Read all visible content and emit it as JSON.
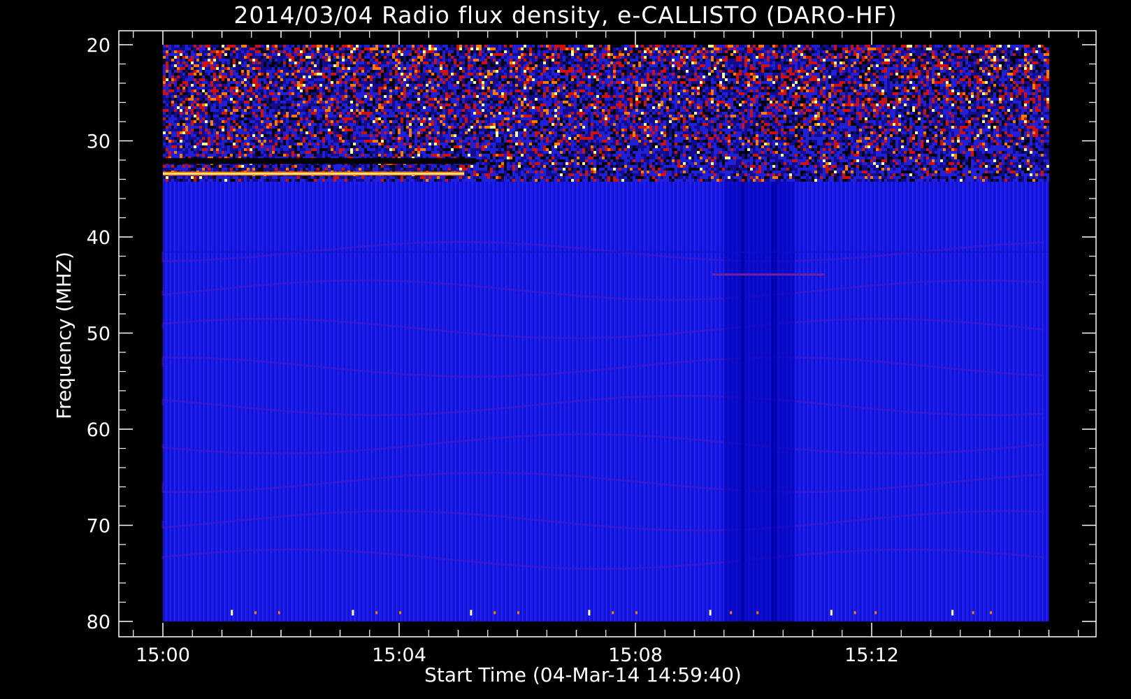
{
  "chart_data": {
    "type": "heatmap",
    "title": "2014/03/04  Radio flux density, e-CALLISTO (DARO-HF)",
    "xlabel": "Start Time (04-Mar-14 14:59:40)",
    "ylabel": "Frequency (MHZ)",
    "x_tick_labels": [
      "15:00",
      "15:04",
      "15:08",
      "15:12"
    ],
    "x_tick_minutes": [
      0,
      4,
      8,
      12
    ],
    "y_tick_labels": [
      "20",
      "30",
      "40",
      "50",
      "60",
      "70",
      "80"
    ],
    "y_tick_values": [
      20,
      30,
      40,
      50,
      60,
      70,
      80
    ],
    "ylim": [
      80,
      20
    ],
    "y_inverted": true,
    "data_time_range_minutes": [
      0,
      15
    ],
    "data_freq_range_mhz": [
      20,
      80
    ],
    "colors": {
      "background": "#000000",
      "quiet": "#1a1ae8",
      "low": "#0000b4",
      "mid": "#d01010",
      "high": "#ff7a00",
      "peak": "#ffff90"
    },
    "features": [
      {
        "name": "interference-band",
        "freq_mhz": [
          20,
          34
        ],
        "intensity": "high"
      },
      {
        "name": "bright-line",
        "freq_mhz": [
          33.2,
          33.6
        ],
        "time_minutes": [
          0,
          5.1
        ],
        "intensity": "peak"
      },
      {
        "name": "dark-line",
        "freq_mhz": [
          31.8,
          32.4
        ],
        "time_minutes": [
          0,
          5.3
        ],
        "intensity": "none"
      },
      {
        "name": "dark-column",
        "time_minutes": [
          9.5,
          10.7
        ],
        "intensity": "low"
      }
    ]
  }
}
